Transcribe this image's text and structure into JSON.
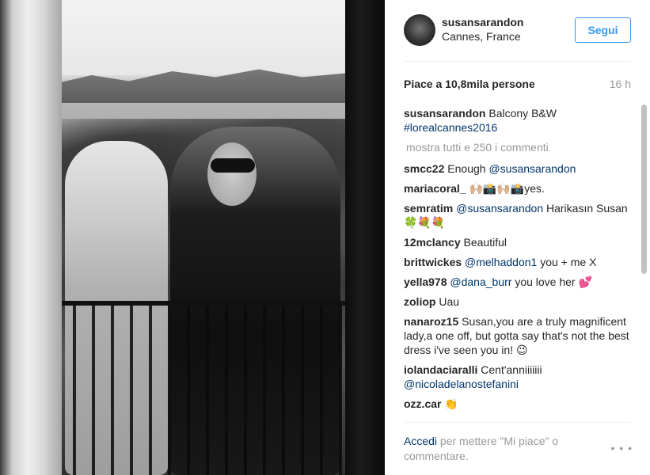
{
  "post": {
    "username": "susansarandon",
    "location": "Cannes, France",
    "follow_label": "Segui",
    "likes": "Piace a 10,8mila persone",
    "time": "16 h"
  },
  "caption": {
    "user": "susansarandon",
    "text": "Balcony B&W",
    "hashtag": "#lorealcannes2016"
  },
  "show_all": "mostra tutti e 250 i commenti",
  "comments": [
    {
      "user": "smcc22",
      "text": " Enough ",
      "mention": "@susansarandon",
      "after": ""
    },
    {
      "user": "mariacoral_",
      "text": " 🙌🏼📸🙌🏼📸yes.",
      "mention": "",
      "after": ""
    },
    {
      "user": "semratim",
      "text": " ",
      "mention": "@susansarandon",
      "after": " Harikasın Susan🍀💐💐"
    },
    {
      "user": "12mclancy",
      "text": " Beautiful",
      "mention": "",
      "after": ""
    },
    {
      "user": "brittwickes",
      "text": " ",
      "mention": "@melhaddon1",
      "after": " you + me X"
    },
    {
      "user": "yella978",
      "text": " ",
      "mention": "@dana_burr",
      "after": " you love her 💕"
    },
    {
      "user": "zoliop",
      "text": " Uau",
      "mention": "",
      "after": ""
    },
    {
      "user": "nanaroz15",
      "text": " Susan,you are a truly magnificent lady,a one off, but gotta say that's not the best dress i've seen you in! 😉",
      "mention": "",
      "after": ""
    },
    {
      "user": "iolandaciaralli",
      "text": " Cent'anniiiiiii ",
      "mention": "@nicoladelanostefanini",
      "after": ""
    },
    {
      "user": "ozz.car",
      "text": " 👏",
      "mention": "",
      "after": ""
    }
  ],
  "footer": {
    "login_label": "Accedi",
    "rest": " per mettere \"Mi piace\" o commentare.",
    "more": "• • •"
  },
  "icons": {
    "more": "more-options-icon",
    "avatar": "profile-avatar"
  },
  "colors": {
    "accent": "#3897f0",
    "link": "#003569",
    "muted": "#999999"
  }
}
